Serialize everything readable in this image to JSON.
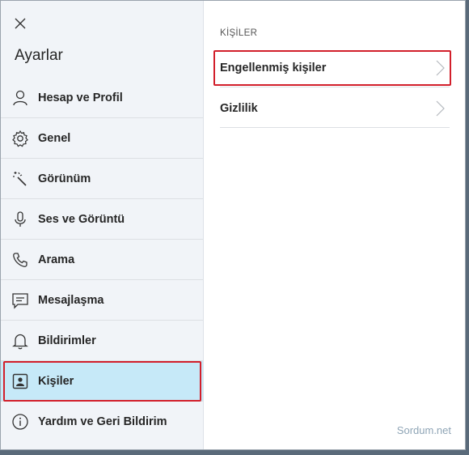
{
  "sidebar": {
    "title": "Ayarlar",
    "items": [
      {
        "label": "Hesap ve Profil",
        "icon": "person-icon"
      },
      {
        "label": "Genel",
        "icon": "gear-icon"
      },
      {
        "label": "Görünüm",
        "icon": "magic-wand-icon"
      },
      {
        "label": "Ses ve Görüntü",
        "icon": "microphone-icon"
      },
      {
        "label": "Arama",
        "icon": "phone-icon"
      },
      {
        "label": "Mesajlaşma",
        "icon": "message-icon"
      },
      {
        "label": "Bildirimler",
        "icon": "bell-icon"
      },
      {
        "label": "Kişiler",
        "icon": "contact-card-icon",
        "active": true
      },
      {
        "label": "Yardım ve Geri Bildirim",
        "icon": "info-icon"
      }
    ]
  },
  "content": {
    "section_title": "KİŞİLER",
    "rows": [
      {
        "label": "Engellenmiş kişiler"
      },
      {
        "label": "Gizlilik"
      }
    ]
  },
  "watermark": "Sordum.net",
  "colors": {
    "active_bg": "#c6e9f8",
    "highlight_border": "#d21f2b",
    "sidebar_bg": "#f1f4f8"
  }
}
